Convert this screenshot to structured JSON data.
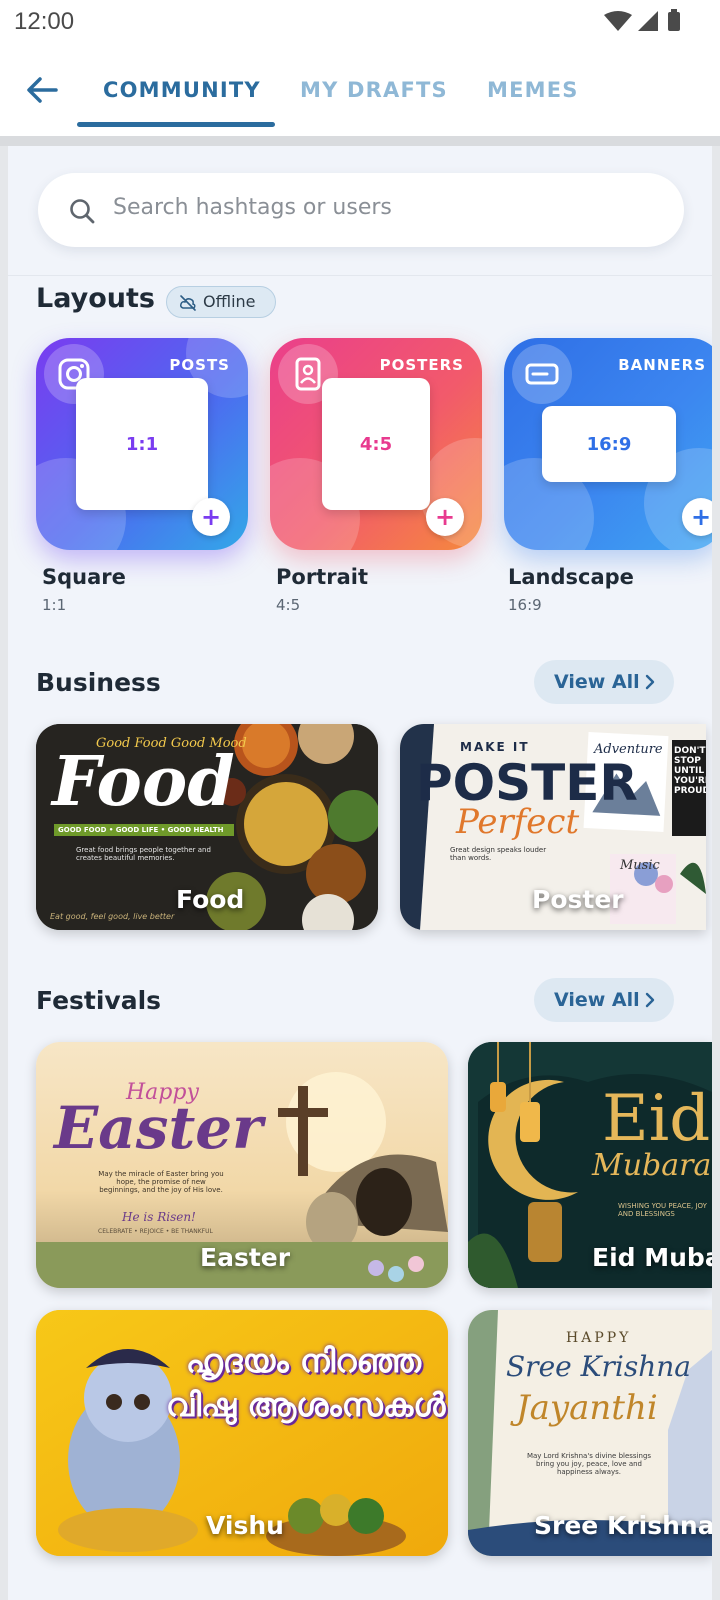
{
  "status_bar": {
    "time": "12:00"
  },
  "tabs": [
    {
      "label": "COMMUNITY",
      "active": true
    },
    {
      "label": "MY DRAFTS",
      "active": false
    },
    {
      "label": "MEMES",
      "active": false
    }
  ],
  "search": {
    "placeholder": "Search hashtags or users"
  },
  "layouts": {
    "title": "Layouts",
    "badge": "Offline",
    "items": [
      {
        "category": "POSTS",
        "ratio_box": "1:1",
        "name": "Square",
        "ratio": "1:1",
        "accent": "#7a3cf0"
      },
      {
        "category": "POSTERS",
        "ratio_box": "4:5",
        "name": "Portrait",
        "ratio": "4:5",
        "accent": "#e83a8f"
      },
      {
        "category": "BANNERS",
        "ratio_box": "16:9",
        "name": "Landscape",
        "ratio": "16:9",
        "accent": "#2f6fe6"
      }
    ]
  },
  "business": {
    "title": "Business",
    "view_all": "View All",
    "items": [
      {
        "label": "Food",
        "art": {
          "headline": "Food",
          "tagline": "Good Food Good Mood",
          "ribbon": "GOOD FOOD • GOOD LIFE • GOOD HEALTH",
          "body": "Great food brings people together and creates beautiful memories.",
          "footer": "Eat good, feel good, live better"
        }
      },
      {
        "label": "Poster",
        "art": {
          "kicker": "MAKE IT",
          "headline": "POSTER",
          "script": "Perfect",
          "body": "Great design speaks louder than words.",
          "side1": "Adventure",
          "side2": "DON'T STOP UNTIL YOU'RE PROUD",
          "side3": "Music"
        }
      }
    ]
  },
  "festivals": {
    "title": "Festivals",
    "view_all": "View All",
    "items": [
      {
        "label": "Easter",
        "art": {
          "script1": "Happy",
          "script2": "Easter",
          "body": "May the miracle of Easter bring you hope, the promise of new beginnings, and the joy of His love.",
          "verse": "He is Risen!",
          "footer": "CELEBRATE • REJOICE • BE THANKFUL"
        }
      },
      {
        "label": "Eid Mubarak",
        "art": {
          "headline": "Eid",
          "script": "Mubarak",
          "body": "WISHING YOU PEACE, JOY AND BLESSINGS"
        }
      },
      {
        "label": "Vishu",
        "art": {
          "line1": "ഹൃദയം നിറഞ്ഞ",
          "line2": "വിഷു ആശംസകൾ"
        }
      },
      {
        "label": "Sree Krishna",
        "art": {
          "kicker": "HAPPY",
          "line1": "Sree Krishna",
          "line2": "Jayanthi",
          "body": "May Lord Krishna's divine blessings bring you joy, peace, love and happiness always."
        }
      }
    ]
  }
}
